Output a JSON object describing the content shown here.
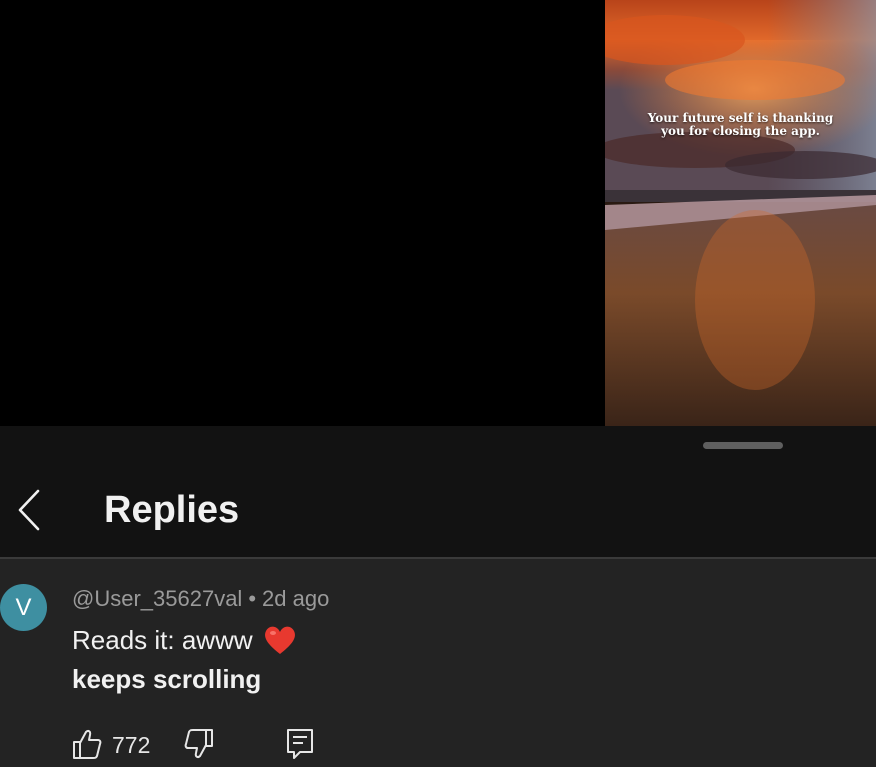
{
  "video": {
    "overlay_line1": "Your future self is thanking",
    "overlay_line2": "you for closing the app."
  },
  "sheet": {
    "title": "Replies",
    "back_icon": "chevron-left-icon"
  },
  "comment": {
    "avatar_letter": "V",
    "avatar_color": "#3e8fa1",
    "author": "@User_35627val",
    "separator": "•",
    "time": "2d ago",
    "line1": "Reads it: awww",
    "emoji": "red-heart-emoji",
    "line2": "keeps scrolling",
    "likes": "772",
    "icons": [
      "thumbs-up-icon",
      "thumbs-down-icon",
      "reply-comment-icon"
    ]
  },
  "colors": {
    "background": "#232323",
    "header_bg": "#121212",
    "muted_text": "#9a9a9a"
  }
}
